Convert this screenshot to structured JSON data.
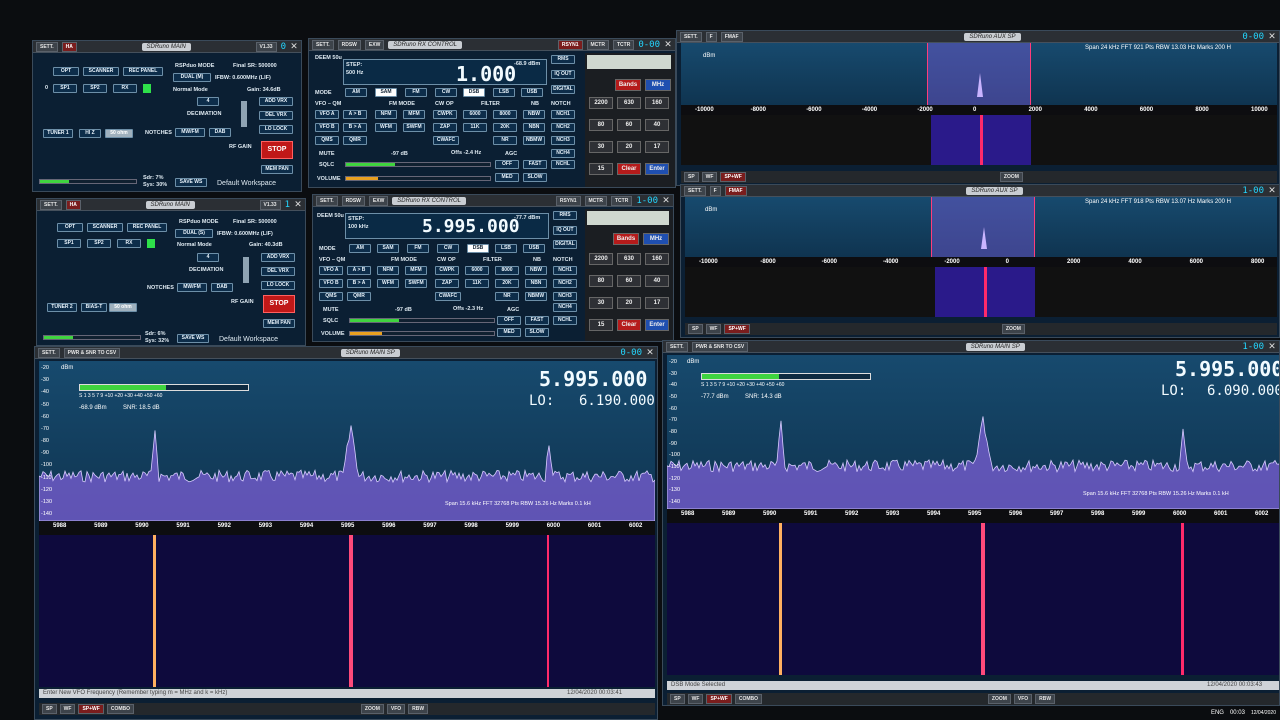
{
  "main1": {
    "sett": "SETT.",
    "ha": "HA",
    "title": "SDRuno MAIN",
    "ver": "V1.33",
    "digits": "0",
    "opt": "OPT",
    "scanner": "SCANNER",
    "rec_panel": "REC PANEL",
    "rsp_mode": "RSPduo MODE",
    "dual": "DUAL (M)",
    "normal_mode": "Normal Mode",
    "final_sr": "Final SR: 500000",
    "ifbw": "IFBW: 0.600MHz (LIF)",
    "gain": "Gain: 34.6dB",
    "sp1": "SP1",
    "sp2": "SP2",
    "rx": "RX",
    "n0": "0",
    "dec_val": "4",
    "decimation": "DECIMATION",
    "add_vrx": "ADD VRX",
    "del_vrx": "DEL VRX",
    "lo_lock": "LO LOCK",
    "tuner": "TUNER 1",
    "hi_z": "HI Z",
    "ohm": "50 ohm",
    "notches": "NOTCHES",
    "mwfm": "MW/FM",
    "dab": "DAB",
    "rf_gain": "RF GAIN",
    "stop": "STOP",
    "mem_pan": "MEM PAN",
    "sdr": "Sdr: 7%",
    "sys": "Sys: 30%",
    "save_ws": "SAVE WS",
    "workspace": "Default Workspace"
  },
  "main2": {
    "sett": "SETT.",
    "ha": "HA",
    "title": "SDRuno MAIN",
    "ver": "V1.33",
    "digits": "1",
    "opt": "OPT",
    "scanner": "SCANNER",
    "rec_panel": "REC PANEL",
    "rsp_mode": "RSPduo MODE",
    "dual": "DUAL (S)",
    "normal_mode": "Normal Mode",
    "final_sr": "Final SR: 500000",
    "ifbw": "IFBW: 0.600MHz (LIF)",
    "gain": "Gain: 40.3dB",
    "sp1": "SP1",
    "sp2": "SP2",
    "rx": "RX",
    "dec_val": "4",
    "decimation": "DECIMATION",
    "add_vrx": "ADD VRX",
    "del_vrx": "DEL VRX",
    "lo_lock": "LO LOCK",
    "tuner": "TUNER 2",
    "hi_z": "BIAS-T",
    "ohm": "50 ohm",
    "notches": "NOTCHES",
    "mwfm": "MW/FM",
    "dab": "DAB",
    "rf_gain": "RF GAIN",
    "stop": "STOP",
    "mem_pan": "MEM PAN",
    "sdr": "Sdr: 6%",
    "sys": "Sys: 32%",
    "save_ws": "SAVE WS",
    "workspace": "Default Workspace"
  },
  "rx1": {
    "sett": "SETT.",
    "rdsw": "RDSW",
    "exw": "EXW",
    "title": "SDRuno RX CONTROL",
    "rsyn": "RSYN1",
    "mctr": "MCTR",
    "tctr": "TCTR",
    "digits": "0-00",
    "deem": "DEEM 50u",
    "step": "STEP:",
    "step_val": "500 Hz",
    "freq": "1.000",
    "dbm": "-68.9 dBm",
    "rms": "RMS",
    "iq_out": "IQ OUT",
    "digital": "DIGITAL",
    "mode": "MODE",
    "am": "AM",
    "sam": "SAM",
    "fm": "FM",
    "cw": "CW",
    "dsb": "DSB",
    "lsb": "LSB",
    "usb": "USB",
    "vfo_qm": "VFO – QM",
    "fm_mode": "FM MODE",
    "cw_op": "CW OP",
    "filter": "FILTER",
    "nb": "NB",
    "notch": "NOTCH",
    "vfo_a": "VFO A",
    "a_b": "A > B",
    "nfm": "NFM",
    "mfm": "MFM",
    "cwpk": "CWPK",
    "f1": "6000",
    "f2": "8000",
    "nbw": "NBW",
    "nch1": "NCH1",
    "vfo_b": "VFO B",
    "b_a": "B > A",
    "wfm": "WFM",
    "swfm": "SWFM",
    "zap": "ZAP",
    "f3": "11K",
    "f4": "20K",
    "nbn": "NBN",
    "nch2": "NCH2",
    "qms": "QMS",
    "qmr": "QMR",
    "cwafc": "CWAFC",
    "nr": "NR",
    "nbmw": "NBMW",
    "nch3": "NCH3",
    "mute": "MUTE",
    "sig_dbm": "-97 dB",
    "nch4": "NCH4",
    "sqlc": "SQLC",
    "offs": "Offs -2.4 Hz",
    "agc": "AGC",
    "off": "OFF",
    "fast": "FAST",
    "nchl": "NCHL",
    "volume": "VOLUME",
    "med": "MED",
    "slow": "SLOW"
  },
  "rx2": {
    "sett": "SETT.",
    "rdsw": "RDSW",
    "exw": "EXW",
    "title": "SDRuno RX CONTROL",
    "rsyn": "RSYN1",
    "mctr": "MCTR",
    "tctr": "TCTR",
    "digits": "1-00",
    "deem": "DEEM 50u",
    "step": "STEP:",
    "step_val": "100 kHz",
    "freq": "5.995.000",
    "dbm": "-77.7 dBm",
    "rms": "RMS",
    "iq_out": "IQ OUT",
    "digital": "DIGITAL",
    "mode": "MODE",
    "am": "AM",
    "sam": "SAM",
    "fm": "FM",
    "cw": "CW",
    "dsb": "DSB",
    "lsb": "LSB",
    "usb": "USB",
    "vfo_qm": "VFO – QM",
    "fm_mode": "FM MODE",
    "cw_op": "CW OP",
    "filter": "FILTER",
    "nb": "NB",
    "notch": "NOTCH",
    "vfo_a": "VFO A",
    "a_b": "A > B",
    "nfm": "NFM",
    "mfm": "MFM",
    "cwpk": "CWPK",
    "f1": "6000",
    "f2": "8000",
    "nbw": "NBW",
    "nch1": "NCH1",
    "vfo_b": "VFO B",
    "b_a": "B > A",
    "wfm": "WFM",
    "swfm": "SWFM",
    "zap": "ZAP",
    "f3": "11K",
    "f4": "20K",
    "nbn": "NBN",
    "nch2": "NCH2",
    "qms": "QMS",
    "qmr": "QMR",
    "cwafc": "CWAFC",
    "nr": "NR",
    "nbmw": "NBMW",
    "nch3": "NCH3",
    "mute": "MUTE",
    "sig_dbm": "-97 dB",
    "nch4": "NCH4",
    "sqlc": "SQLC",
    "offs": "Offs -2.3 Hz",
    "agc": "AGC",
    "off": "OFF",
    "fast": "FAST",
    "nchl": "NCHL",
    "volume": "VOLUME",
    "med": "MED",
    "slow": "SLOW"
  },
  "keypad": {
    "bands": "Bands",
    "mhz": "MHz",
    "keys": [
      "2200",
      "630",
      "160",
      "80",
      "60",
      "40",
      "30",
      "20",
      "17",
      "15",
      "Clear",
      "Enter"
    ]
  },
  "aux1": {
    "sett": "SETT.",
    "f": "F",
    "fmaf": "FMAF",
    "title": "SDRuno AUX SP",
    "digits": "0-00",
    "dbm": "dBm",
    "info": "Span 24 kHz   FFT 921 Pts   RBW 13.03 Hz   Marks 200 H",
    "ticks": [
      "-10000",
      "-8000",
      "-6000",
      "-4000",
      "-2000",
      "0",
      "2000",
      "4000",
      "6000",
      "8000",
      "10000"
    ],
    "sp": "SP",
    "wf": "WF",
    "spwf": "SP+WF",
    "zoom": "ZOOM"
  },
  "aux2": {
    "sett": "SETT.",
    "f": "F",
    "fmaf": "FMAF",
    "title": "SDRuno AUX SP",
    "digits": "1-00",
    "dbm": "dBm",
    "info": "Span 24 kHz   FFT 918 Pts   RBW 13.07 Hz   Marks 200 H",
    "ticks": [
      "-10000",
      "-8000",
      "-6000",
      "-4000",
      "-2000",
      "0",
      "2000",
      "4000",
      "6000",
      "8000"
    ],
    "sp": "SP",
    "wf": "WF",
    "spwf": "SP+WF",
    "zoom": "ZOOM"
  },
  "sp1": {
    "sett": "SETT.",
    "pwr": "PWR & SNR TO CSV",
    "title": "SDRuno MAIN SP",
    "digits": "0-00",
    "freq": "5.995.000",
    "lo_label": "LO:",
    "lo": "6.190.000",
    "dbm_label": "dBm",
    "meter_scale": "S 1 3 5 7 9 +10 +20 +30 +40 +50 +60",
    "level": "-68.9 dBm",
    "snr": "SNR: 18.5 dB",
    "info": "Span 15.6 kHz   FFT 32768 Pts   RBW 15.26 Hz   Marks 0.1 kH",
    "yticks": [
      "-20",
      "-30",
      "-40",
      "-50",
      "-60",
      "-70",
      "-80",
      "-90",
      "-100",
      "-110",
      "-120",
      "-130",
      "-140"
    ],
    "xticks": [
      "5988",
      "5989",
      "5990",
      "5991",
      "5992",
      "5993",
      "5994",
      "5995",
      "5996",
      "5997",
      "5998",
      "5999",
      "6000",
      "6001",
      "6002"
    ],
    "status": "Enter New VFO Frequency (Remember typing m = MHz and k = kHz)",
    "timestamp": "12/04/2020 00:03:41",
    "sp": "SP",
    "wf": "WF",
    "spwf": "SP+WF",
    "combo": "COMBO",
    "zoom": "ZOOM",
    "vfo": "VFO",
    "rbw": "RBW"
  },
  "sp2": {
    "sett": "SETT.",
    "pwr": "PWR & SNR TO CSV",
    "title": "SDRuno MAIN SP",
    "digits": "1-00",
    "freq": "5.995.000",
    "lo_label": "LO:",
    "lo": "6.090.000",
    "dbm_label": "dBm",
    "meter_scale": "S 1 3 5 7 9 +10 +20 +30 +40 +50 +60",
    "level": "-77.7 dBm",
    "snr": "SNR: 14.3 dB",
    "info": "Span 15.6 kHz   FFT 32768 Pts   RBW 15.26 Hz   Marks 0.1 kH",
    "yticks": [
      "-20",
      "-30",
      "-40",
      "-50",
      "-60",
      "-70",
      "-80",
      "-90",
      "-100",
      "-110",
      "-120",
      "-130",
      "-140"
    ],
    "xticks": [
      "5988",
      "5989",
      "5990",
      "5991",
      "5992",
      "5993",
      "5994",
      "5995",
      "5996",
      "5997",
      "5998",
      "5999",
      "6000",
      "6001",
      "6002"
    ],
    "status": "DSB Mode Selected",
    "timestamp": "12/04/2020 00:03:43",
    "sp": "SP",
    "wf": "WF",
    "spwf": "SP+WF",
    "combo": "COMBO",
    "zoom": "ZOOM",
    "vfo": "VFO",
    "rbw": "RBW"
  },
  "taskbar": {
    "lang": "ENG",
    "time": "00:03",
    "date": "12/04/2020"
  },
  "colors": {
    "accent": "#23d6ff",
    "stop": "#c01818",
    "spectrum_fill": "#7b5fd6",
    "waterfall": "#0e0a3d",
    "marker": "#ff2a6a"
  }
}
